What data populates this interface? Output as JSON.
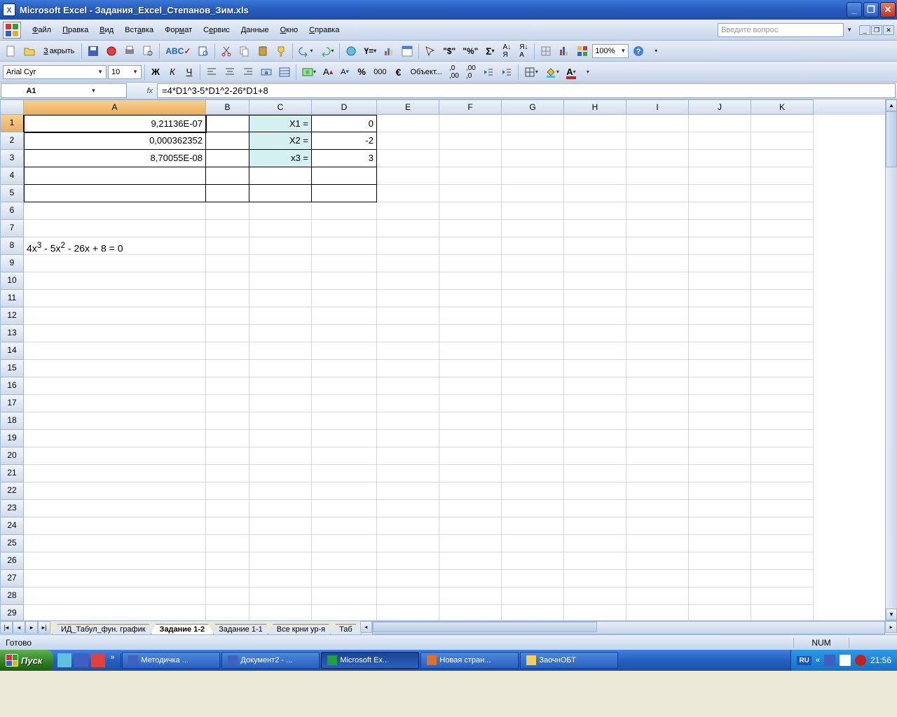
{
  "title": "Microsoft Excel - Задания_Excel_Степанов_Зим.xls",
  "menu": {
    "file": "Файл",
    "edit": "Правка",
    "view": "Вид",
    "insert": "Вставка",
    "format": "Формат",
    "tools": "Сервис",
    "data": "Данные",
    "window": "Окно",
    "help": "Справка"
  },
  "ask_placeholder": "Введите вопрос",
  "toolbar": {
    "close": "Закрыть",
    "zoom": "100%",
    "object": "Объект..."
  },
  "format": {
    "font": "Arial Cyr",
    "size": "10",
    "bold": "Ж",
    "italic": "К",
    "underline": "Ч"
  },
  "namebox": "A1",
  "fx": "fx",
  "formula": "=4*D1^3-5*D1^2-26*D1+8",
  "columns": [
    "A",
    "B",
    "C",
    "D",
    "E",
    "F",
    "G",
    "H",
    "I",
    "J",
    "K"
  ],
  "rows": 29,
  "cells": {
    "A1": "9,21136E-07",
    "A2": "0,000362352",
    "A3": "8,70055E-08",
    "C1": "X1 =",
    "C2": "X2 =",
    "C3": "x3 =",
    "D1": "0",
    "D2": "-2",
    "D3": "3"
  },
  "equation_html": "4x<sup>3</sup> - 5x<sup>2</sup> - 26x + 8 = 0",
  "sheets": {
    "s1": "ИД_Табул_фун. график",
    "active": "Задание 1-2",
    "s3": "Задание 1-1",
    "s4": "Все крни ур-я",
    "s5": "Таб"
  },
  "status": {
    "ready": "Готово",
    "num": "NUM"
  },
  "taskbar": {
    "start": "Пуск",
    "items": {
      "t1": "Методичка ...",
      "t2": "Документ2 - ...",
      "t3": "Microsoft Ex...",
      "t4": "Новая стран...",
      "t5": "ЗаочнОБТ"
    },
    "lang": "RU",
    "clock": "21:56",
    "more": "«"
  }
}
